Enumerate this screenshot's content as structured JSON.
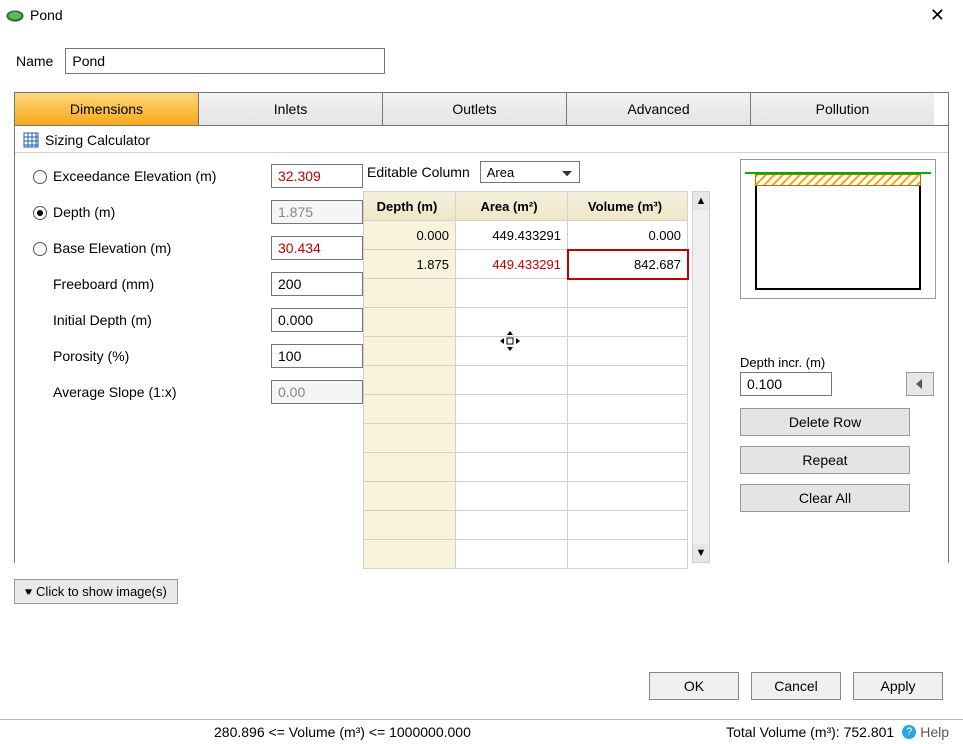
{
  "window": {
    "title": "Pond"
  },
  "name": {
    "label": "Name",
    "value": "Pond"
  },
  "tabs": [
    {
      "label": "Dimensions",
      "active": true
    },
    {
      "label": "Inlets"
    },
    {
      "label": "Outlets"
    },
    {
      "label": "Advanced"
    },
    {
      "label": "Pollution"
    }
  ],
  "section_heading": "Sizing Calculator",
  "params": {
    "exceedance_elev": {
      "label": "Exceedance Elevation (m)",
      "value": "32.309"
    },
    "depth": {
      "label": "Depth (m)",
      "value": "1.875"
    },
    "base_elev": {
      "label": "Base Elevation (m)",
      "value": "30.434"
    },
    "freeboard": {
      "label": "Freeboard (mm)",
      "value": "200"
    },
    "initial_depth": {
      "label": "Initial Depth (m)",
      "value": "0.000"
    },
    "porosity": {
      "label": "Porosity (%)",
      "value": "100"
    },
    "avg_slope": {
      "label": "Average Slope (1:x)",
      "value": "0.00"
    }
  },
  "editable_column": {
    "label": "Editable Column",
    "value": "Area"
  },
  "grid": {
    "headers": {
      "depth": "Depth (m)",
      "area": "Area (m²)",
      "volume": "Volume (m³)"
    },
    "rows": [
      {
        "depth": "0.000",
        "area": "449.433291",
        "volume": "0.000"
      },
      {
        "depth": "1.875",
        "area": "449.433291",
        "volume": "842.687",
        "area_red": true,
        "vol_highlight": true
      }
    ],
    "blank_rows": 10
  },
  "right": {
    "depth_incr_label": "Depth incr. (m)",
    "depth_incr_value": "0.100",
    "delete_row": "Delete Row",
    "repeat": "Repeat",
    "clear_all": "Clear All"
  },
  "show_images": "Click to show image(s)",
  "buttons": {
    "ok": "OK",
    "cancel": "Cancel",
    "apply": "Apply"
  },
  "status": {
    "volume_range": "280.896 <= Volume (m³) <= 1000000.000",
    "total_volume": "Total Volume (m³): 752.801",
    "help": "Help"
  }
}
